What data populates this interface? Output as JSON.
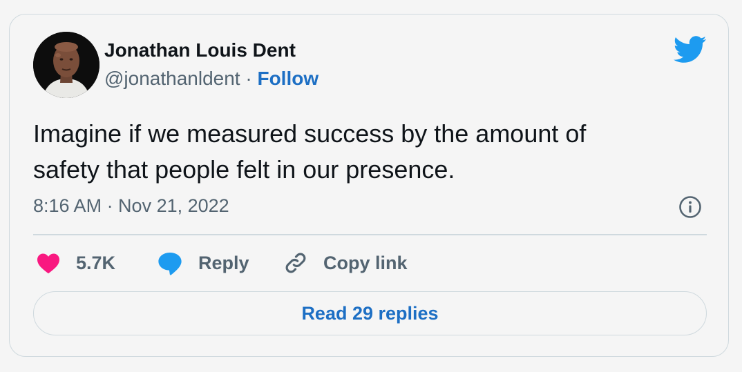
{
  "tweet": {
    "author": {
      "name": "Jonathan Louis Dent",
      "handle": "@jonathanldent",
      "separator": "·",
      "follow_label": "Follow"
    },
    "text": "Imagine if we measured success by the amount of safety that people felt in our presence.",
    "timestamp": "8:16 AM · Nov 21, 2022",
    "actions": {
      "likes_count": "5.7K",
      "reply_label": "Reply",
      "copy_link_label": "Copy link"
    },
    "read_replies_label": "Read 29 replies"
  },
  "colors": {
    "brand": "#1d9bf0",
    "link": "#1d6fc4",
    "like": "#f91880",
    "text_primary": "#0f1419",
    "text_secondary": "#536471",
    "border": "#cfd9de"
  },
  "icons": {
    "brand": "twitter-bird-icon",
    "info": "info-icon",
    "like": "heart-icon",
    "reply": "speech-bubble-icon",
    "copy": "link-icon"
  }
}
